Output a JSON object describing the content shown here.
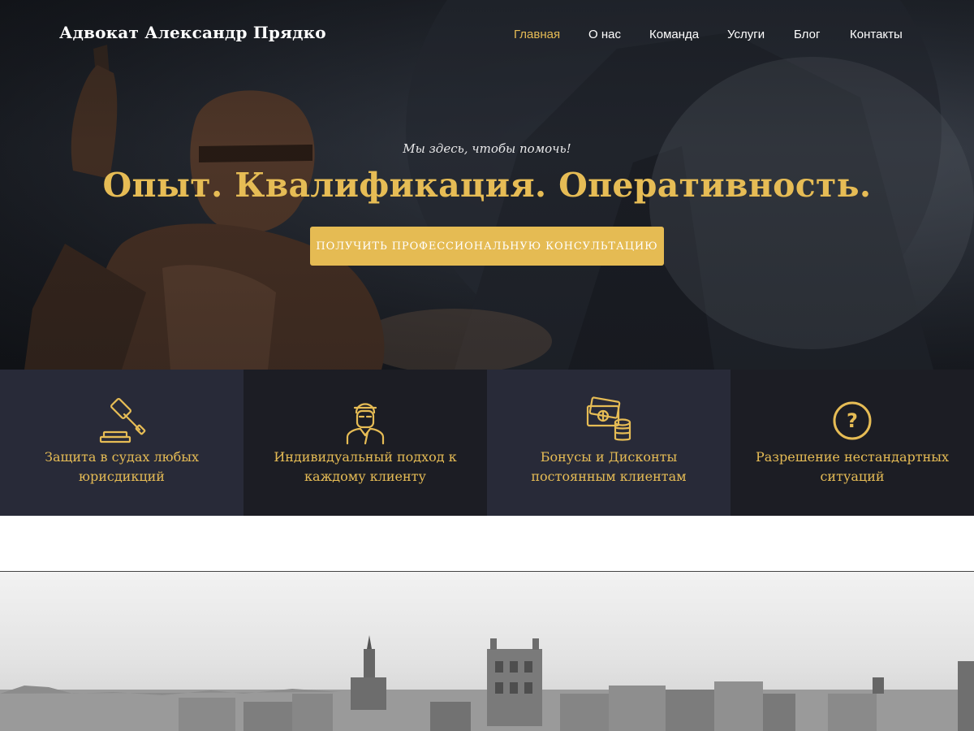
{
  "header": {
    "brand": "Адвокат Александр Прядко",
    "nav": [
      {
        "label": "Главная",
        "active": true
      },
      {
        "label": "О нас",
        "active": false
      },
      {
        "label": "Команда",
        "active": false
      },
      {
        "label": "Услуги",
        "active": false
      },
      {
        "label": "Блог",
        "active": false
      },
      {
        "label": "Контакты",
        "active": false
      }
    ]
  },
  "hero": {
    "tagline": "Мы здесь, чтобы помочь!",
    "headline": "Опыт. Квалификация. Оперативность.",
    "cta_label": "ПОЛУЧИТЬ ПРОФЕССИОНАЛЬНУЮ КОНСУЛЬТАЦИЮ",
    "background_image": "lady-justice-statue-photo"
  },
  "features": [
    {
      "icon": "gavel-icon",
      "text": "Защита в судах любых юрисдикций"
    },
    {
      "icon": "lawyer-icon",
      "text": "Индивидуальный подход к каждому клиенту"
    },
    {
      "icon": "money-coins-icon",
      "text": "Бонусы и Дисконты постоянным клиентам"
    },
    {
      "icon": "question-circle-icon",
      "text": "Разрешение нестандартных ситуаций"
    }
  ],
  "city_banner": {
    "image": "city-skyline-photo"
  },
  "colors": {
    "accent": "#e6bc55",
    "feature_light": "#282a38",
    "feature_dark": "#1c1d24",
    "text_light": "#ffffff"
  }
}
